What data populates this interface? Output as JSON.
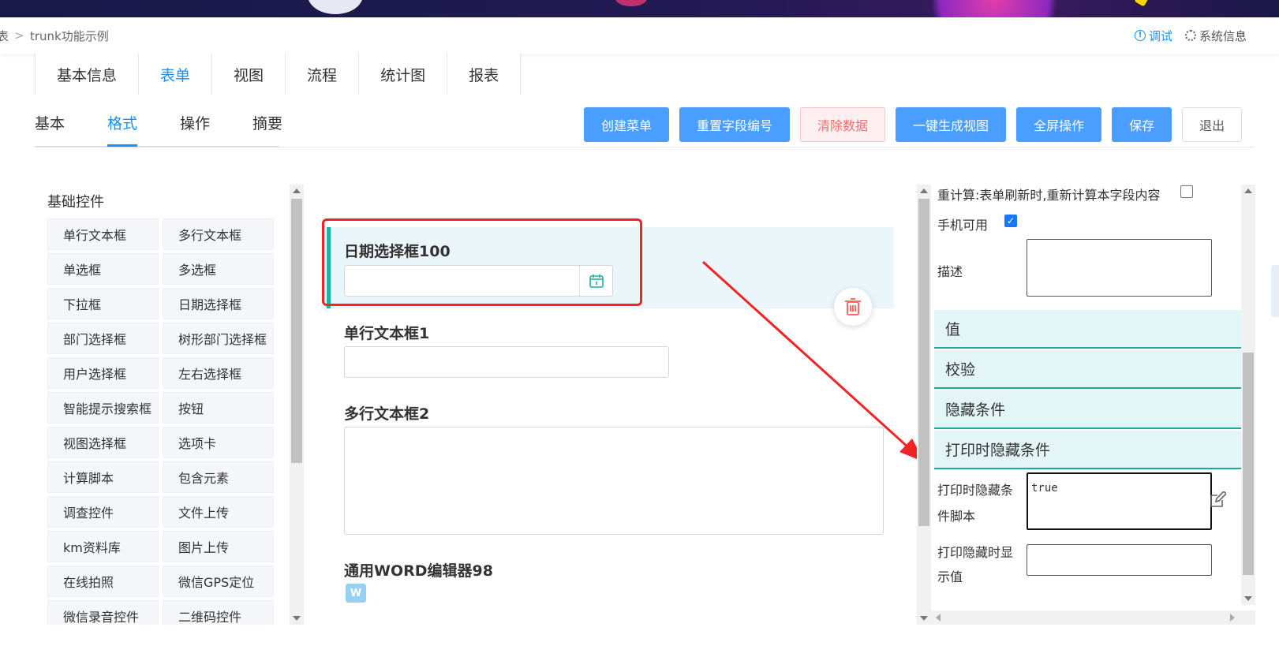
{
  "breadcrumb": {
    "prev": "表",
    "separator": ">",
    "current": "trunk功能示例"
  },
  "header_actions": {
    "debug": "调试",
    "system_info": "系统信息"
  },
  "main_tabs": [
    {
      "label": "基本信息"
    },
    {
      "label": "表单",
      "active": true
    },
    {
      "label": "视图"
    },
    {
      "label": "流程"
    },
    {
      "label": "统计图"
    },
    {
      "label": "报表"
    }
  ],
  "sub_tabs": [
    {
      "label": "基本"
    },
    {
      "label": "格式",
      "active": true
    },
    {
      "label": "操作"
    },
    {
      "label": "摘要"
    }
  ],
  "toolbar": {
    "create_menu": "创建菜单",
    "reset_field_no": "重置字段编号",
    "clear_data": "清除数据",
    "gen_view": "一键生成视图",
    "fullscreen": "全屏操作",
    "save": "保存",
    "exit": "退出"
  },
  "controls": {
    "title": "基础控件",
    "items": [
      "单行文本框",
      "多行文本框",
      "单选框",
      "多选框",
      "下拉框",
      "日期选择框",
      "部门选择框",
      "树形部门选择框",
      "用户选择框",
      "左右选择框",
      "智能提示搜索框",
      "按钮",
      "视图选择框",
      "选项卡",
      "计算脚本",
      "包含元素",
      "调查控件",
      "文件上传",
      "km资料库",
      "图片上传",
      "在线拍照",
      "微信GPS定位",
      "微信录音控件",
      "二维码控件"
    ]
  },
  "canvas": {
    "fields": [
      {
        "label": "日期选择框100",
        "type": "date",
        "selected": true
      },
      {
        "label": "单行文本框1",
        "type": "text"
      },
      {
        "label": "多行文本框2",
        "type": "textarea"
      },
      {
        "label": "通用WORD编辑器98",
        "type": "word"
      }
    ],
    "word_icon": "W"
  },
  "properties": {
    "recalc_label": "重计算:表单刷新时,重新计算本字段内容",
    "recalc_checked": false,
    "mobile_label": "手机可用",
    "mobile_checked": true,
    "desc_label": "描述",
    "sections": [
      "值",
      "校验",
      "隐藏条件",
      "打印时隐藏条件"
    ],
    "print_hide_script_label_1": "打印时隐藏条",
    "print_hide_script_label_2": "件脚本",
    "print_hide_script_value": "true",
    "print_hide_display_label_1": "打印隐藏时显",
    "print_hide_display_label_2": "示值"
  },
  "colors": {
    "primary": "#1890ff",
    "button_blue": "#4a9eff",
    "teal_accent": "#1fb3a5",
    "annotation_red": "#f02424",
    "danger": "#f56c6c"
  }
}
